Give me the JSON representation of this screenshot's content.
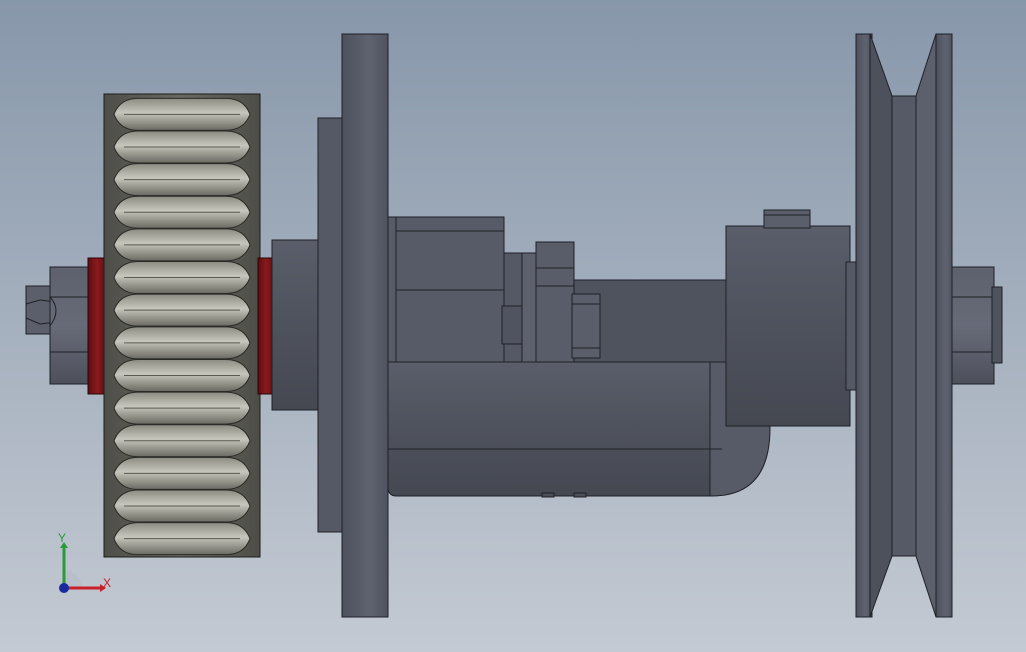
{
  "viewport": {
    "background_top": "#8797aa",
    "background_bottom": "#c4cad3"
  },
  "model": {
    "parts": [
      {
        "name": "gear",
        "color": "#55554f"
      },
      {
        "name": "spacer",
        "color": "#7c1518"
      },
      {
        "name": "flange-plate",
        "color": "#5c606e"
      },
      {
        "name": "housing",
        "color": "#4f535e"
      },
      {
        "name": "v-pulley",
        "color": "#5a5e6c"
      },
      {
        "name": "hex-nut",
        "color": "#5b5f6b"
      }
    ]
  },
  "triad": {
    "x_label": "X",
    "y_label": "Y",
    "x_color": "#c8202a",
    "y_color": "#2a9a3a",
    "z_color": "#1a2a9c"
  }
}
